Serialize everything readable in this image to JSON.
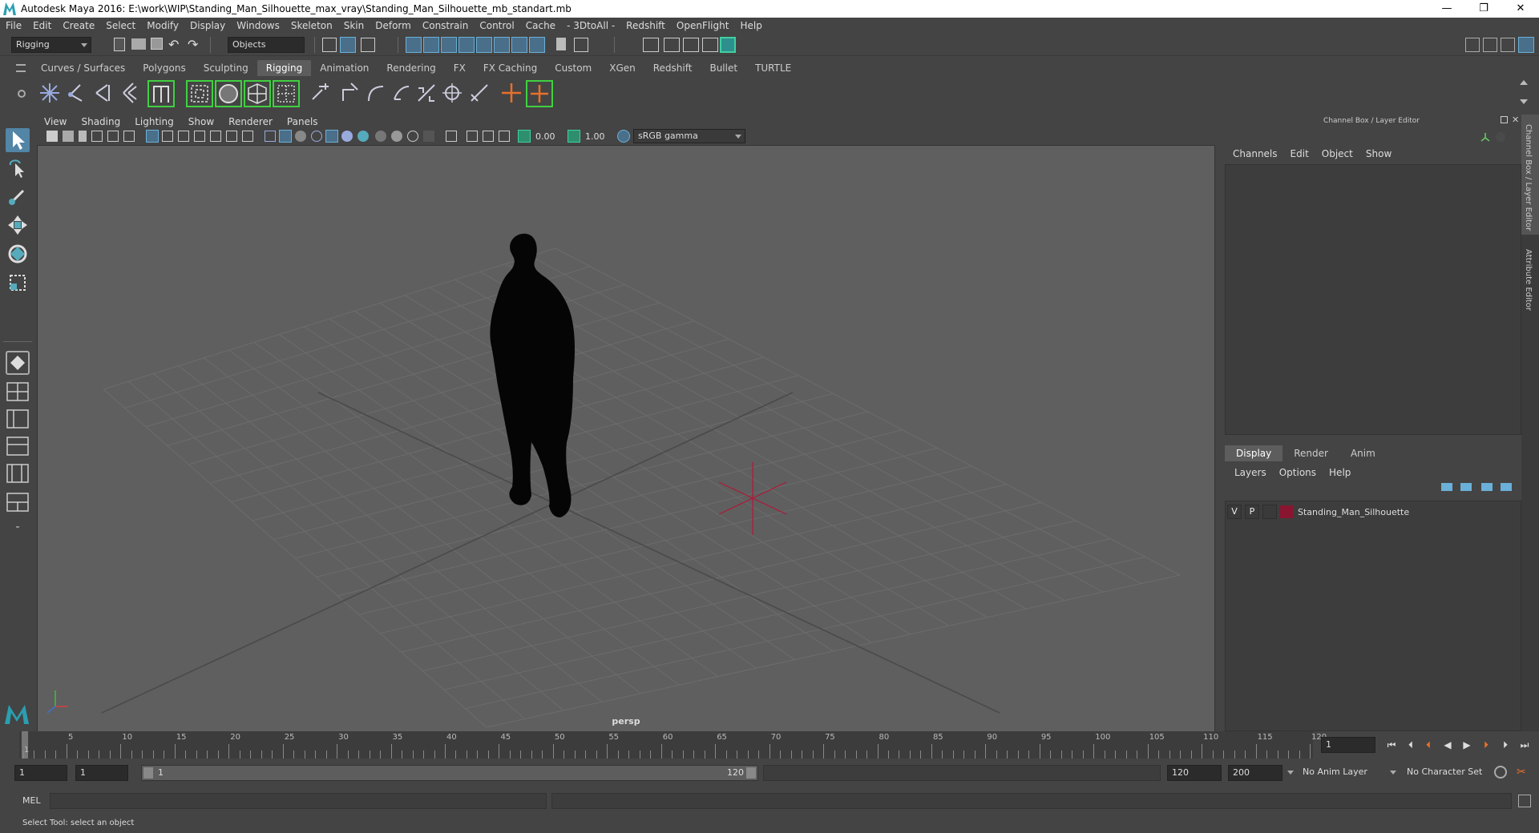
{
  "window": {
    "title": "Autodesk Maya 2016: E:\\work\\WIP\\Standing_Man_Silhouette_max_vray\\Standing_Man_Silhouette_mb_standart.mb",
    "minimize": "—",
    "restore": "❐",
    "close": "✕"
  },
  "menubar": [
    "File",
    "Edit",
    "Create",
    "Select",
    "Modify",
    "Display",
    "Windows",
    "Skeleton",
    "Skin",
    "Deform",
    "Constrain",
    "Control",
    "Cache",
    "- 3DtoAll -",
    "Redshift",
    "OpenFlight",
    "Help"
  ],
  "statusline": {
    "menuset": "Rigging",
    "selection_mode": "Objects"
  },
  "shelf_tabs": [
    "Curves / Surfaces",
    "Polygons",
    "Sculpting",
    "Rigging",
    "Animation",
    "Rendering",
    "FX",
    "FX Caching",
    "Custom",
    "XGen",
    "Redshift",
    "Bullet",
    "TURTLE"
  ],
  "shelf_active": "Rigging",
  "viewport": {
    "menu": [
      "View",
      "Shading",
      "Lighting",
      "Show",
      "Renderer",
      "Panels"
    ],
    "exposure": "0.00",
    "gamma": "1.00",
    "colorspace": "sRGB gamma",
    "camera_label": "persp"
  },
  "channel_box": {
    "title": "Channel Box / Layer Editor",
    "menu": [
      "Channels",
      "Edit",
      "Object",
      "Show"
    ]
  },
  "layer_editor": {
    "tabs": [
      "Display",
      "Render",
      "Anim"
    ],
    "active_tab": "Display",
    "menu": [
      "Layers",
      "Options",
      "Help"
    ],
    "layers": [
      {
        "v": "V",
        "p": "P",
        "name": "Standing_Man_Silhouette",
        "color": "#8a1530"
      }
    ]
  },
  "side_tabs": [
    "Channel Box / Layer Editor",
    "Attribute Editor"
  ],
  "timeslider": {
    "labels": [
      "1",
      "5",
      "10",
      "15",
      "20",
      "25",
      "30",
      "35",
      "40",
      "45",
      "50",
      "55",
      "60",
      "65",
      "70",
      "75",
      "80",
      "85",
      "90",
      "95",
      "100",
      "105",
      "110",
      "115",
      "120"
    ],
    "current_frame": "1"
  },
  "range": {
    "start": "1",
    "playback_start": "1",
    "slider_start": "1",
    "slider_end": "120",
    "playback_end": "120",
    "end": "200",
    "anim_layer": "No Anim Layer",
    "character_set": "No Character Set"
  },
  "cmdline": {
    "label": "MEL"
  },
  "helpline": {
    "text": "Select Tool: select an object"
  }
}
